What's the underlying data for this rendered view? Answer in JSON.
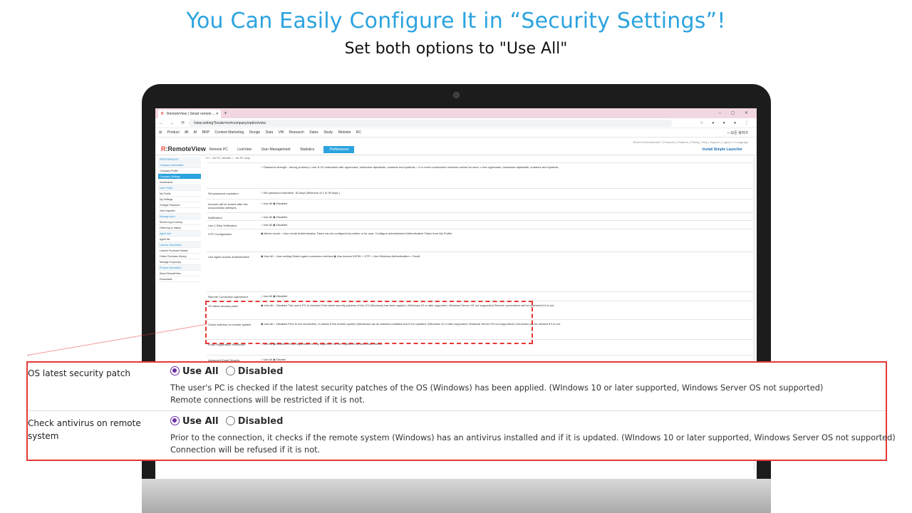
{
  "headline": "You Can Easily Configure It in “Security Settings”!",
  "subheadline": "Set both options to \"Use All\"",
  "browser": {
    "tab_title": "RemoteView | Smart remote ...",
    "url": "/view.setting?locale=en#company/option/view",
    "bookmarks": [
      "Product",
      "All",
      "AI",
      "BRP",
      "Content Marketing",
      "Design",
      "Data",
      "VM",
      "Research",
      "Sales",
      "Study",
      "Website",
      "RC"
    ],
    "bookmarks_right": "□ 모든 북마크"
  },
  "app": {
    "top_links": "What is RemoteView? | Products | Features | Pricing | Help | Support | Logout | ≥ Language",
    "logo_brand": "R",
    "logo_text": ":RemoteView",
    "menu": [
      "Remote PC",
      "LiveView",
      "User Management",
      "Statistics"
    ],
    "menu_active": "Preferences",
    "launcher": "Install Simple Launcher",
    "breadcrumb": "□+□ : for PC, Mobile  □ : for PC only"
  },
  "sidebar": [
    {
      "label": "PREFERENCES",
      "type": "head"
    },
    {
      "label": "Company Information",
      "type": "head"
    },
    {
      "label": "Company Profile",
      "type": "item"
    },
    {
      "label": "Company Settings",
      "type": "sel"
    },
    {
      "label": "Viewboards",
      "type": "item"
    },
    {
      "label": "User Profile",
      "type": "head"
    },
    {
      "label": "My Profile",
      "type": "item"
    },
    {
      "label": "My Settings",
      "type": "item"
    },
    {
      "label": "Change Password",
      "type": "item"
    },
    {
      "label": "View Inquiries",
      "type": "item"
    },
    {
      "label": "Manage log in",
      "type": "head"
    },
    {
      "label": "Recent log in history",
      "type": "item"
    },
    {
      "label": "Failed log in history",
      "type": "item"
    },
    {
      "label": "Agent Info.",
      "type": "head"
    },
    {
      "label": "Agent list",
      "type": "item"
    },
    {
      "label": "License Information",
      "type": "head"
    },
    {
      "label": "License Purchase Details",
      "type": "item"
    },
    {
      "label": "Online Purchase History",
      "type": "item"
    },
    {
      "label": "Manage Coupon(s)",
      "type": "item"
    },
    {
      "label": "Product Information",
      "type": "head"
    },
    {
      "label": "About RemoteView",
      "type": "item"
    },
    {
      "label": "Downloads",
      "type": "item"
    }
  ],
  "rows": [
    {
      "label": "",
      "value": "○ Password strength : strong (custom)  • Use 8~20 characters with uppercase, lowercase alphabets, numbers and symbols.  • 3 or more consecutive numbers cannot be used.  • Use uppercase, lowercase alphabets, numbers and symbols."
    },
    {
      "label": "Set password expiration.",
      "value": "□ Set password expiration.  30  days (Minimum of 1 to 99 days.)"
    },
    {
      "label": "Account will be locked after five unsuccessful attempts.",
      "value": "○ Use All  ◉ Disabled"
    },
    {
      "label": "Notification",
      "value": "○ Use All  ◉ Disabled"
    },
    {
      "label": "Use 2-Step Verification",
      "value": "○ Use All  ◉ Disabled"
    },
    {
      "label": "OTP Configuration",
      "value": "◉ Admin mode  ○ User mode  Authentication Token can be configured by admin or for user.  Configure administrator Authentication Token from My Profile."
    },
    {
      "label": "Use Agent access authentication",
      "value": "◉ Use All  ○ User setting  Select agent connection method  ◉ Use Access ID/PW  ○ OTP  ○ Use Windows Authentication  ○ Email"
    },
    {
      "label": "Remote Connection Agreement",
      "value": "○ Use All  ◉ Disabled"
    },
    {
      "label": "OS latest security patch",
      "value": "◉ Use All  ○ Disabled  The user's PC is checked if the latest security patches of the OS (Windows) has been applied. (WIndows 10 or later supported, Windows Server OS not supported)  Remote connections will be restricted if it is not."
    },
    {
      "label": "Check antivirus on remote system",
      "value": "◉ Use All  ○ Disabled  Prior to the connection, it checks if the remote system (Windows) has an antivirus installed and if it is updated. (WIndows 10 or later supported, Windows Server OS not supported)  Connection will be refused if it is not."
    },
    {
      "label": "Email Registration Restriction",
      "value": "○ Use All  ◉ Disabled  Email registration is only supported for the registered domains listed below."
    },
    {
      "label": "Advanced Email Security",
      "value": "○ Use All  ◉ Disable"
    }
  ],
  "zoom": {
    "row1": {
      "label": "OS latest security patch",
      "opt_on": "Use All",
      "opt_off": "Disabled",
      "desc1": "The user's PC is checked if the latest security patches of the OS (Windows) has been applied. (WIndows 10 or later supported, Windows Server OS not supported)",
      "desc2": "Remote connections will be restricted if it is not."
    },
    "row2": {
      "label": "Check antivirus on remote system",
      "opt_on": "Use All",
      "opt_off": "Disabled",
      "desc1": "Prior to the connection, it checks if the remote system (Windows) has an antivirus installed and if it is updated. (WIndows 10 or later supported, Windows Server OS not supported)",
      "desc2": "Connection will be refused if it is not."
    }
  },
  "colors": {
    "headline": "#2ba3df",
    "highlight": "#e53935",
    "radio": "#6b2fa3"
  }
}
